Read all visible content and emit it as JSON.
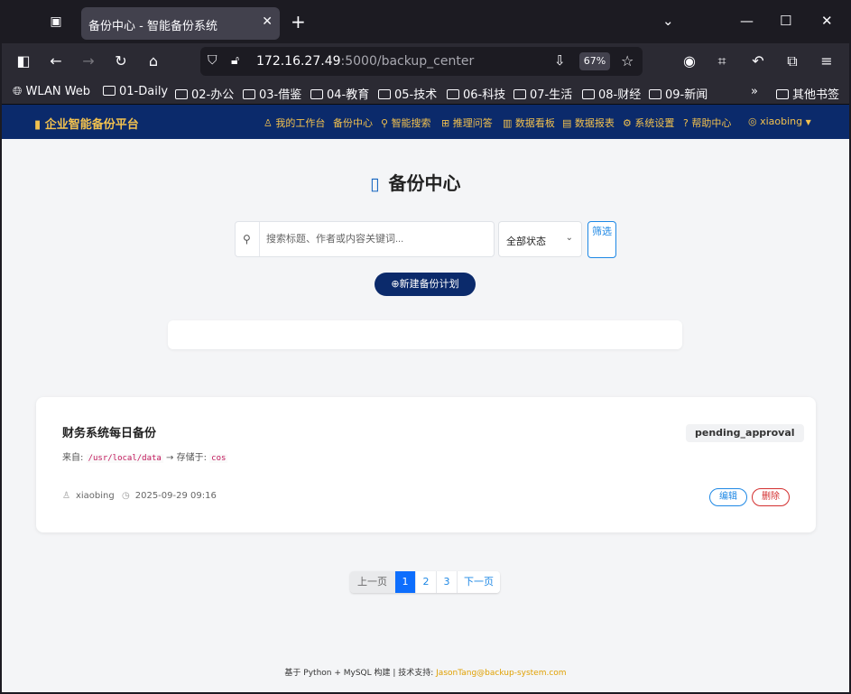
{
  "browser": {
    "tab_title": "备份中心 - 智能备份系统",
    "url_host": "172.16.27.49",
    "url_path": ":5000/backup_center",
    "zoom": "67%"
  },
  "bookmarks": [
    "WLAN Web",
    "01-Daily",
    "02-办公",
    "03-借鉴",
    "04-教育",
    "05-技术",
    "06-科技",
    "07-生活",
    "08-财经",
    "09-新闻"
  ],
  "bookmarks_other": "其他书签",
  "app": {
    "brand": "企业智能备份平台",
    "menu": [
      "我的工作台",
      "备份中心",
      "智能搜索",
      "推理问答",
      "数据看板",
      "数据报表",
      "系统设置",
      "帮助中心"
    ],
    "user": "xiaobing"
  },
  "page": {
    "title": "备份中心",
    "search_placeholder": "搜索标题、作者或内容关键词...",
    "status_filter": "全部状态",
    "filter_button": "筛选",
    "new_button": "新建备份计划"
  },
  "card": {
    "title": "财务系统每日备份",
    "status": "pending_approval",
    "source_label": "来自:",
    "source_path": "/usr/local/data",
    "arrow": "→",
    "dest_label": "存储于:",
    "dest": "cos",
    "author": "xiaobing",
    "time": "2025-09-29 09:16",
    "edit": "编辑",
    "delete": "删除"
  },
  "pager": {
    "prev": "上一页",
    "pages": [
      "1",
      "2",
      "3"
    ],
    "next": "下一页"
  },
  "footer": {
    "text": "基于 Python + MySQL 构建 | 技术支持: ",
    "contact": "JasonTang@backup-system.com"
  },
  "colors": {
    "header_bg": "#0b2a6b",
    "accent_gold": "#f2c14e",
    "primary_blue": "#1e88e5",
    "danger_red": "#d32f2f"
  }
}
